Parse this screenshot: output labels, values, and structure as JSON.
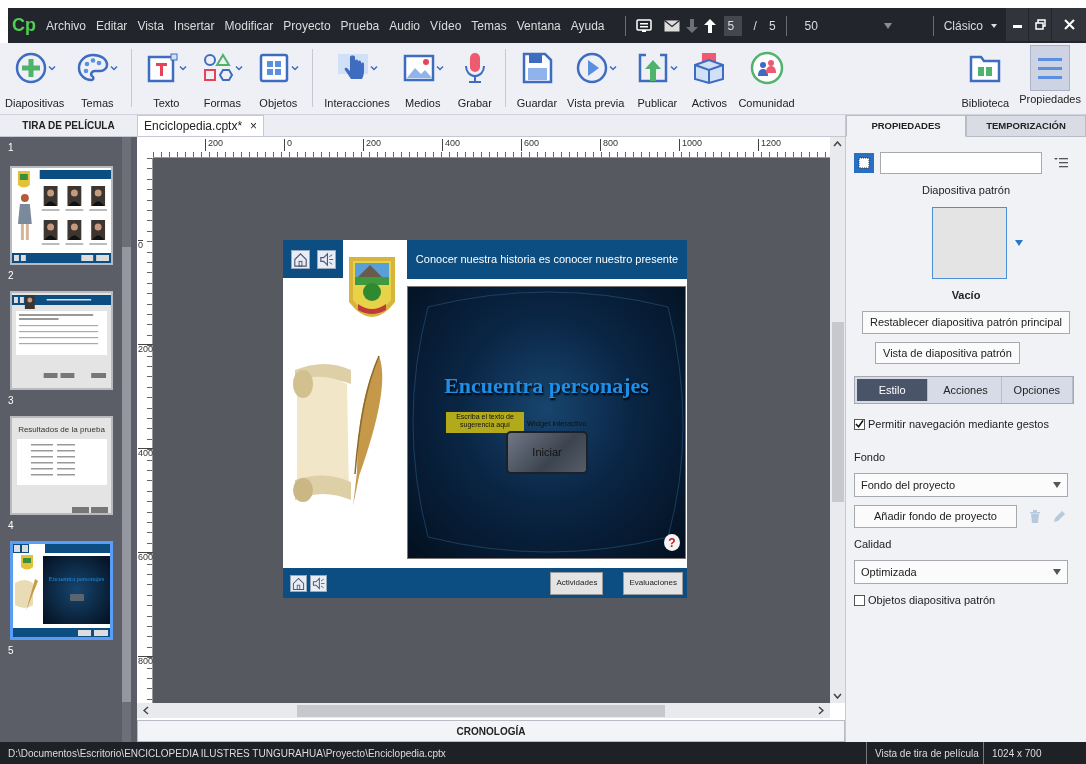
{
  "app": {
    "logo": "Cp"
  },
  "menu": [
    "Archivo",
    "Editar",
    "Vista",
    "Insertar",
    "Modificar",
    "Proyecto",
    "Prueba",
    "Audio",
    "Vídeo",
    "Temas",
    "Ventana",
    "Ayuda"
  ],
  "slide_nav": {
    "current": "5",
    "separator": "/",
    "total": "5",
    "zoom": "50"
  },
  "workspace": {
    "label": "Clásico"
  },
  "toolbar": {
    "groups": [
      [
        {
          "label": "Diapositivas",
          "kind": "add",
          "dropdown": true
        },
        {
          "label": "Temas",
          "kind": "palette",
          "dropdown": true
        }
      ],
      [
        {
          "label": "Texto",
          "kind": "text",
          "dropdown": true
        },
        {
          "label": "Formas",
          "kind": "shapes",
          "dropdown": true
        },
        {
          "label": "Objetos",
          "kind": "objects",
          "dropdown": true
        }
      ],
      [
        {
          "label": "Interacciones",
          "kind": "interaction",
          "dropdown": true
        },
        {
          "label": "Medios",
          "kind": "media",
          "dropdown": true
        },
        {
          "label": "Grabar",
          "kind": "record",
          "dropdown": false
        }
      ],
      [
        {
          "label": "Guardar",
          "kind": "save",
          "dropdown": false
        },
        {
          "label": "Vista previa",
          "kind": "preview",
          "dropdown": true
        },
        {
          "label": "Publicar",
          "kind": "publish",
          "dropdown": true
        },
        {
          "label": "Activos",
          "kind": "assets",
          "dropdown": false
        },
        {
          "label": "Comunidad",
          "kind": "community",
          "dropdown": false
        }
      ]
    ],
    "right": [
      {
        "label": "Biblioteca",
        "kind": "library",
        "selected": false
      },
      {
        "label": "Propiedades",
        "kind": "properties",
        "selected": true
      }
    ]
  },
  "filmstrip": {
    "title": "TIRA DE PELÍCULA",
    "slides": [
      {
        "number": "1",
        "kind": "hidden"
      },
      {
        "number": "2",
        "kind": "portraits",
        "selected": false
      },
      {
        "number": "3",
        "kind": "quiz",
        "selected": false
      },
      {
        "number": "4",
        "kind": "results",
        "title": "Resultados de la prueba",
        "selected": false
      },
      {
        "number": "5",
        "kind": "title",
        "title": "Encuentra personajes",
        "selected": true
      }
    ]
  },
  "document_tab": {
    "label": "Enciclopedia.cptx*",
    "close": "×",
    "selected": true
  },
  "rulers": {
    "horizontal": [
      "200",
      "0",
      "200",
      "400",
      "600",
      "800",
      "1000",
      "1200"
    ],
    "vertical": [
      "0",
      "200",
      "400",
      "600",
      "800"
    ]
  },
  "slide": {
    "header": "Conocer nuestra historia es conocer nuestro presente",
    "title": "Encuentra personajes",
    "hint": "Escriba el texto de sugerencia aquí",
    "widget_label": "Widget interactivo",
    "start_button": "Iniciar",
    "help": "?",
    "footer_buttons": [
      "Actividades",
      "Evaluaciones"
    ]
  },
  "properties_panel": {
    "tabs": [
      {
        "label": "PROPIEDADES",
        "selected": true
      },
      {
        "label": "TEMPORIZACIÓN",
        "selected": false
      }
    ],
    "master_slide_label": "Diapositiva patrón",
    "master_slide_name": "Vacío",
    "buttons": [
      "Restablecer diapositiva patrón principal",
      "Vista de diapositiva patrón"
    ],
    "subtabs": [
      {
        "label": "Estilo",
        "selected": true
      },
      {
        "label": "Acciones",
        "selected": false
      },
      {
        "label": "Opciones",
        "selected": false
      }
    ],
    "gestures": {
      "label": "Permitir navegación mediante gestos",
      "checked": true
    },
    "background_label": "Fondo",
    "background_value": "Fondo del proyecto",
    "add_background_button": "Añadir fondo de proyecto",
    "quality_label": "Calidad",
    "quality_value": "Optimizada",
    "master_objects": {
      "label": "Objetos diapositiva patrón",
      "checked": false
    }
  },
  "timeline": {
    "label": "CRONOLOGÍA"
  },
  "status_bar": {
    "path": "D:\\Documentos\\Escritorio\\ENCICLOPEDIA ILUSTRES TUNGURAHUA\\Proyecto\\Enciclopedia.cptx",
    "view": "Vista de tira de película",
    "size": "1024 x 700"
  }
}
